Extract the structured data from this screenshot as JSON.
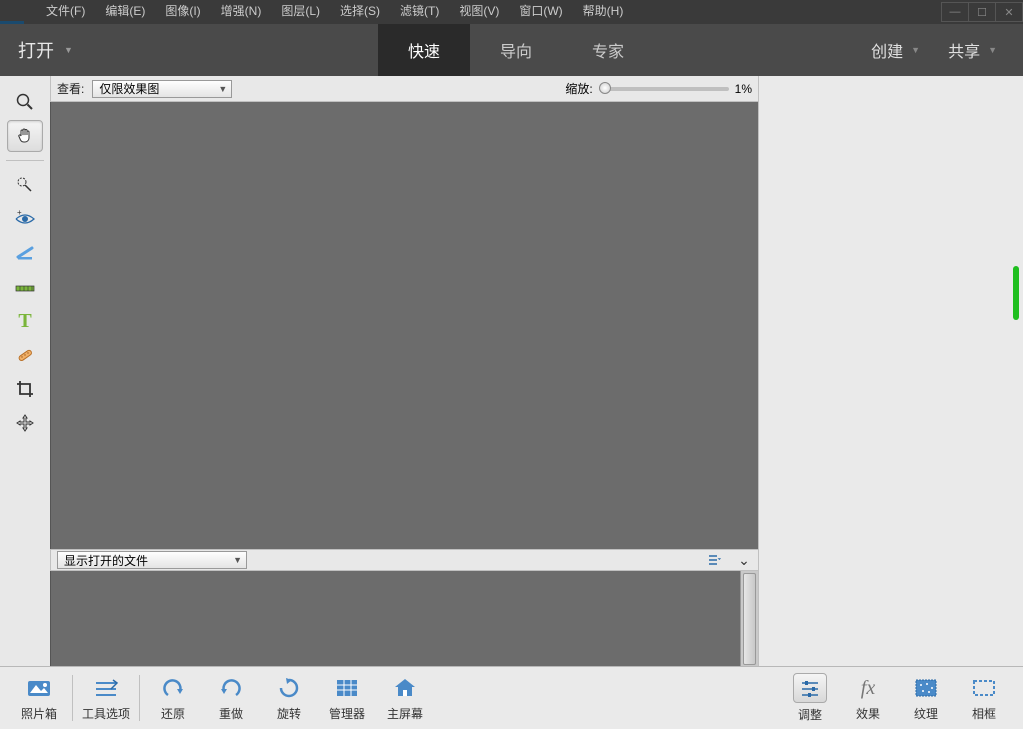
{
  "menubar": {
    "items": [
      "文件(F)",
      "编辑(E)",
      "图像(I)",
      "增强(N)",
      "图层(L)",
      "选择(S)",
      "滤镜(T)",
      "视图(V)",
      "窗口(W)",
      "帮助(H)"
    ]
  },
  "modebar": {
    "open_label": "打开",
    "tabs": [
      {
        "label": "快速",
        "active": true
      },
      {
        "label": "导向",
        "active": false
      },
      {
        "label": "专家",
        "active": false
      }
    ],
    "create_label": "创建",
    "share_label": "共享"
  },
  "options": {
    "view_label": "查看:",
    "view_value": "仅限效果图",
    "zoom_label": "缩放:",
    "zoom_value": "1%"
  },
  "midbar": {
    "dropdown_value": "显示打开的文件"
  },
  "bottombar": {
    "left": [
      {
        "name": "photo-bin",
        "label": "照片箱"
      },
      {
        "name": "tool-options",
        "label": "工具选项"
      }
    ],
    "mid": [
      {
        "name": "undo",
        "label": "还原"
      },
      {
        "name": "redo",
        "label": "重做"
      },
      {
        "name": "rotate",
        "label": "旋转"
      },
      {
        "name": "organizer",
        "label": "管理器"
      },
      {
        "name": "home",
        "label": "主屏幕"
      }
    ],
    "right": [
      {
        "name": "adjust",
        "label": "调整"
      },
      {
        "name": "effects",
        "label": "效果"
      },
      {
        "name": "textures",
        "label": "纹理"
      },
      {
        "name": "frames",
        "label": "相框"
      }
    ]
  }
}
